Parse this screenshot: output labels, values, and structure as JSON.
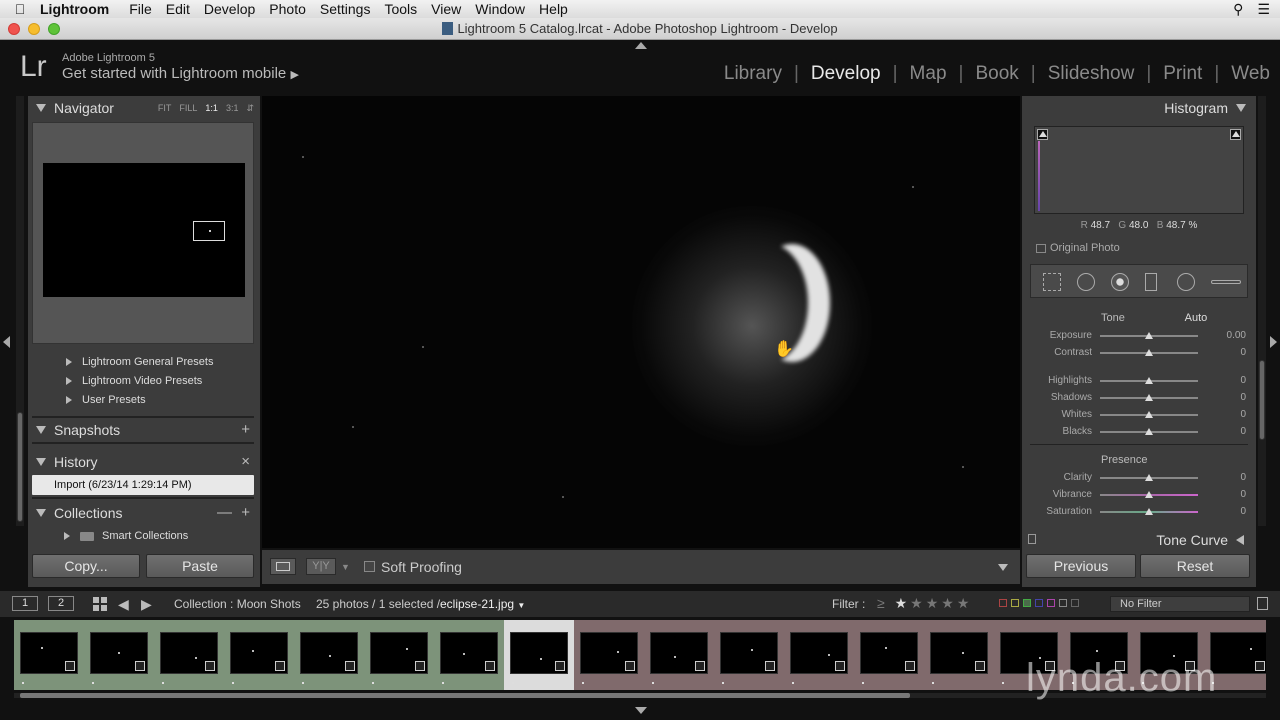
{
  "menubar": {
    "items": [
      "Lightroom",
      "File",
      "Edit",
      "Develop",
      "Photo",
      "Settings",
      "Tools",
      "View",
      "Window",
      "Help"
    ]
  },
  "window": {
    "title": "Lightroom 5 Catalog.lrcat - Adobe Photoshop Lightroom - Develop"
  },
  "identity": {
    "logo": "Lr",
    "version": "Adobe Lightroom 5",
    "mobile_link": "Get started with Lightroom mobile",
    "modules": [
      "Library",
      "Develop",
      "Map",
      "Book",
      "Slideshow",
      "Print",
      "Web"
    ],
    "active_module": "Develop"
  },
  "navigator": {
    "title": "Navigator",
    "zoom_options": [
      "FIT",
      "FILL",
      "1:1",
      "3:1"
    ],
    "zoom_selected": "1:1"
  },
  "presets": {
    "items": [
      "Lightroom General Presets",
      "Lightroom Video Presets",
      "User Presets"
    ]
  },
  "snapshots": {
    "title": "Snapshots",
    "action": "+"
  },
  "history": {
    "title": "History",
    "action": "×",
    "items": [
      "Import (6/23/14 1:29:14 PM)"
    ]
  },
  "collections": {
    "title": "Collections",
    "items": [
      "Smart Collections"
    ]
  },
  "left_buttons": {
    "copy": "Copy...",
    "paste": "Paste"
  },
  "toolbar": {
    "yy": "Y|Y",
    "soft_proofing": "Soft Proofing"
  },
  "histogram": {
    "title": "Histogram",
    "r_label": "R",
    "r_value": "48.7",
    "g_label": "G",
    "g_value": "48.0",
    "b_label": "B",
    "b_value": "48.7 %",
    "original_photo": "Original Photo"
  },
  "basic": {
    "tone_label": "Tone",
    "auto_label": "Auto",
    "rows": [
      {
        "label": "Exposure",
        "value": "0.00"
      },
      {
        "label": "Contrast",
        "value": "0"
      },
      {
        "label": "Highlights",
        "value": "0"
      },
      {
        "label": "Shadows",
        "value": "0"
      },
      {
        "label": "Whites",
        "value": "0"
      },
      {
        "label": "Blacks",
        "value": "0"
      }
    ],
    "presence_label": "Presence",
    "presence_rows": [
      {
        "label": "Clarity",
        "value": "0"
      },
      {
        "label": "Vibrance",
        "value": "0"
      },
      {
        "label": "Saturation",
        "value": "0"
      }
    ]
  },
  "tone_curve": {
    "title": "Tone Curve"
  },
  "right_buttons": {
    "previous": "Previous",
    "reset": "Reset"
  },
  "filmstrip_bar": {
    "page1": "1",
    "page2": "2",
    "collection": "Collection : Moon Shots",
    "count": "25 photos / 1 selected /",
    "filename": "eclipse-21.jpg",
    "filter_label": "Filter :",
    "filter_op": "≥",
    "no_filter": "No Filter"
  },
  "watermark": "lynda.com",
  "colors": {
    "panel_bg": "#3c3c3c",
    "green_cell": "#7d937a",
    "pink_cell": "#806a6c",
    "selected_cell": "#dcdcdc"
  }
}
